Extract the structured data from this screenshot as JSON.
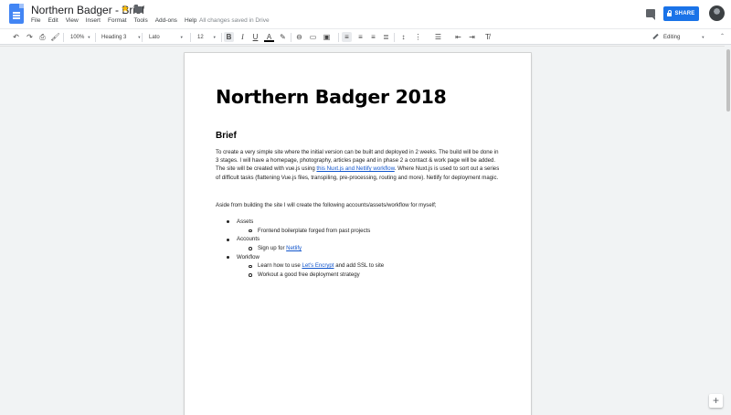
{
  "header": {
    "title": "Northern Badger - Brief",
    "save_status": "All changes saved in Drive",
    "share_label": "SHARE",
    "icons": {
      "doc": "docs-icon",
      "star": "star-icon",
      "folder": "folder-icon",
      "comment": "comment-icon",
      "lock": "lock-icon",
      "avatar": "avatar"
    },
    "accent_color": "#1a73e8",
    "star_color": "#fbbc04"
  },
  "menu": [
    "File",
    "Edit",
    "View",
    "Insert",
    "Format",
    "Tools",
    "Add-ons",
    "Help"
  ],
  "toolbar": {
    "zoom": "100%",
    "style": "Heading 3",
    "font": "Lato",
    "size": "12",
    "mode": "Editing",
    "icons": [
      "undo-icon",
      "redo-icon",
      "print-icon",
      "paint-format-icon",
      "bold-icon",
      "italic-icon",
      "underline-icon",
      "text-color-icon",
      "highlight-icon",
      "link-icon",
      "comment-add-icon",
      "image-icon",
      "align-left-icon",
      "align-center-icon",
      "align-right-icon",
      "justify-icon",
      "line-spacing-icon",
      "numbered-list-icon",
      "bulleted-list-icon",
      "decrease-indent-icon",
      "increase-indent-icon",
      "clear-formatting-icon",
      "pencil-icon",
      "collapse-icon"
    ]
  },
  "document": {
    "heading": "Northern Badger 2018",
    "section": "Brief",
    "para1_a": "To create a very simple site where the initial version can be built and deployed in 2 weeks. The build will be done in 3 stages.  I will have a homepage, photography, articles page and in phase 2 a contact & work page will be added. The site will be created with vue.js using ",
    "para1_link": "this Nuxt.js and Netlify workflow",
    "para1_b": ". Where Nuxt.js is used to sort out a series of difficult tasks (flattening Vue.js files, transpiling,  pre-processing, routing and more). Netlify for deployment magic.",
    "para2": "Aside from building the site I will create the following accounts/assets/workflow for myself;",
    "list": {
      "assets": "Assets",
      "assets_sub": "Frontend boilerplate forged from past projects",
      "accounts": "Accounts",
      "accounts_sub_a": "Sign up for ",
      "accounts_sub_link": "Netlify",
      "workflow": "Workflow",
      "workflow_sub1_a": "Learn how to use ",
      "workflow_sub1_link": "Let's Encrypt",
      "workflow_sub1_b": " and add SSL to site",
      "workflow_sub2": "Workout a good free deployment strategy"
    },
    "link_color": "#1155cc"
  }
}
